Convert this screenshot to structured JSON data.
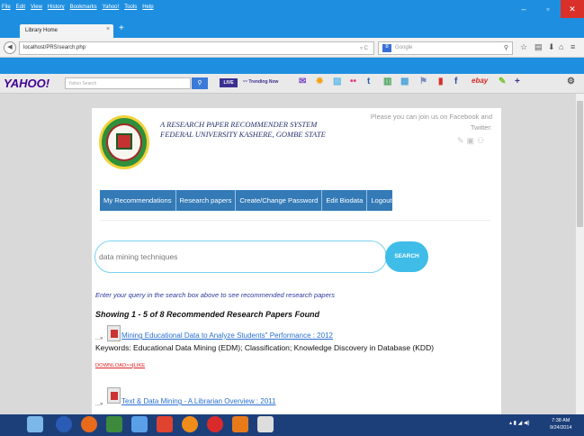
{
  "browser": {
    "menu_items": [
      "File",
      "Edit",
      "View",
      "History",
      "Bookmarks",
      "Yahoo!",
      "Tools",
      "Help"
    ],
    "tab_title": "Library Home",
    "tab_close": "×",
    "new_tab": "+",
    "url": "localhost/PRS/search.php",
    "reload": "▿ C",
    "search_placeholder": "Google",
    "search_engine_badge": "8"
  },
  "yahoo_toolbar": {
    "logo": "YAHOO!",
    "search_placeholder": "Yahoo Search",
    "live": "LIVE",
    "trending": "Trending Now",
    "ebay": "ebay"
  },
  "page": {
    "title_line1": "A RESEARCH PAPER RECOMMENDER SYSTEM",
    "title_line2": "FEDERAL UNIVERSITY KASHERE, GOMBE STATE",
    "join_text": "Please you can join us on Facebook and Twitter:",
    "nav": [
      "My Recommendations",
      "Research papers",
      "Create/Change Password",
      "Edit Biodata",
      "Logout"
    ],
    "search_value": "data mining techniques",
    "search_button": "SEARCH",
    "hint": "Enter your query in the search box above to see recommended research papers",
    "result_count": "Showing 1 - 5 of 8 Recommended Research Papers Found",
    "results": [
      {
        "title": "Mining Educational Data to Analyze Students\" Performance : 2012",
        "keywords": "Keywords: Educational Data Mining (EDM); Classification; Knowledge Discovery in Database (KDD)",
        "download": "DOWNLOAD>>",
        "separator": "|",
        "like": "LIKE"
      },
      {
        "title": "Text & Data Mining - A Librarian Overview : 2011"
      }
    ],
    "arrow": "...»"
  },
  "taskbar": {
    "time": "7:38 AM",
    "date": "9/24/2014"
  },
  "colors": {
    "chrome_blue": "#1e8fe0",
    "nav_blue": "#337ab7",
    "search_button": "#3fbce8",
    "link": "#2a6fd1"
  }
}
